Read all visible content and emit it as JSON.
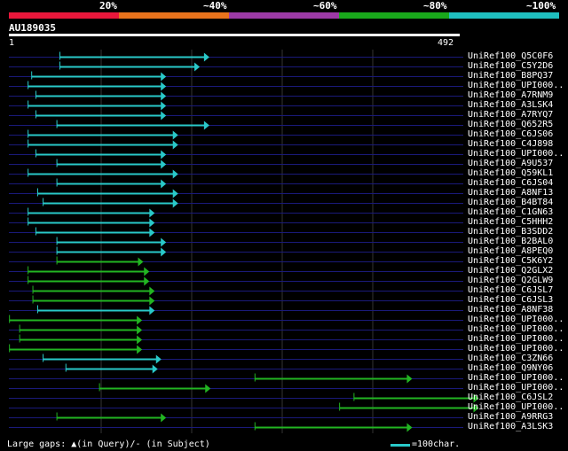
{
  "header": {
    "scale_labels": [
      "20%",
      "~40%",
      "~60%",
      "~80%",
      "~100%"
    ],
    "scale_colors": [
      "#e8173b",
      "#e8731c",
      "#9c3aa6",
      "#19a81b",
      "#1fbfbf"
    ],
    "query_id": "AU189035",
    "query_start": "1",
    "query_end": "492"
  },
  "colors": {
    "background": "#000000",
    "row_line": "#1a1a7a",
    "grid": "#333333",
    "cyan": "#29c9c9",
    "green": "#22b522"
  },
  "query_length": 492,
  "hits": [
    {
      "name": "UniRef100_Q5C0F6",
      "start": 85,
      "end": 334,
      "color": "cyan"
    },
    {
      "name": "UniRef100_C5Y2D6",
      "start": 85,
      "end": 318,
      "color": "cyan"
    },
    {
      "name": "UniRef100_B8PQ37",
      "start": 38,
      "end": 262,
      "color": "cyan"
    },
    {
      "name": "UniRef100_UPI000..",
      "start": 32,
      "end": 262,
      "color": "cyan"
    },
    {
      "name": "UniRef100_A7RNM9",
      "start": 45,
      "end": 262,
      "color": "cyan"
    },
    {
      "name": "UniRef100_A3LSK4",
      "start": 32,
      "end": 262,
      "color": "cyan"
    },
    {
      "name": "UniRef100_A7RYQ7",
      "start": 45,
      "end": 262,
      "color": "cyan"
    },
    {
      "name": "UniRef100_Q652R5",
      "start": 80,
      "end": 334,
      "color": "cyan"
    },
    {
      "name": "UniRef100_C6JS06",
      "start": 32,
      "end": 282,
      "color": "cyan"
    },
    {
      "name": "UniRef100_C4J898",
      "start": 32,
      "end": 282,
      "color": "cyan"
    },
    {
      "name": "UniRef100_UPI000..",
      "start": 45,
      "end": 262,
      "color": "cyan"
    },
    {
      "name": "UniRef100_A9U537",
      "start": 80,
      "end": 262,
      "color": "cyan"
    },
    {
      "name": "UniRef100_Q59KL1",
      "start": 32,
      "end": 282,
      "color": "cyan"
    },
    {
      "name": "UniRef100_C6JS04",
      "start": 80,
      "end": 262,
      "color": "cyan"
    },
    {
      "name": "UniRef100_A8NF13",
      "start": 48,
      "end": 282,
      "color": "cyan"
    },
    {
      "name": "UniRef100_B4BT84",
      "start": 57,
      "end": 282,
      "color": "cyan"
    },
    {
      "name": "UniRef100_C1GN63",
      "start": 32,
      "end": 243,
      "color": "cyan"
    },
    {
      "name": "UniRef100_C5HHH2",
      "start": 32,
      "end": 243,
      "color": "cyan"
    },
    {
      "name": "UniRef100_B3SDD2",
      "start": 45,
      "end": 243,
      "color": "cyan"
    },
    {
      "name": "UniRef100_B2BAL0",
      "start": 80,
      "end": 262,
      "color": "cyan"
    },
    {
      "name": "UniRef100_A8PEQ0",
      "start": 80,
      "end": 262,
      "color": "cyan"
    },
    {
      "name": "UniRef100_C5K6Y2",
      "start": 80,
      "end": 224,
      "color": "green"
    },
    {
      "name": "UniRef100_Q2GLX2",
      "start": 32,
      "end": 234,
      "color": "green"
    },
    {
      "name": "UniRef100_Q2GLW9",
      "start": 32,
      "end": 234,
      "color": "green"
    },
    {
      "name": "UniRef100_C6JSL7",
      "start": 40,
      "end": 243,
      "color": "green"
    },
    {
      "name": "UniRef100_C6JSL3",
      "start": 40,
      "end": 243,
      "color": "green"
    },
    {
      "name": "UniRef100_A8NF38",
      "start": 48,
      "end": 243,
      "color": "cyan"
    },
    {
      "name": "UniRef100_UPI000..",
      "start": 1,
      "end": 222,
      "color": "green"
    },
    {
      "name": "UniRef100_UPI000..",
      "start": 18,
      "end": 222,
      "color": "green"
    },
    {
      "name": "UniRef100_UPI000..",
      "start": 18,
      "end": 222,
      "color": "green"
    },
    {
      "name": "UniRef100_UPI000..",
      "start": 1,
      "end": 222,
      "color": "green"
    },
    {
      "name": "UniRef100_C3ZN66",
      "start": 57,
      "end": 254,
      "color": "cyan"
    },
    {
      "name": "UniRef100_Q9NY06",
      "start": 95,
      "end": 248,
      "color": "cyan"
    },
    {
      "name": "UniRef100_UPI000..",
      "start": 410,
      "end": 672,
      "color": "green"
    },
    {
      "name": "UniRef100_UPI000..",
      "start": 151,
      "end": 336,
      "color": "green"
    },
    {
      "name": "UniRef100_C6JSL2",
      "start": 575,
      "end": 783,
      "color": "green"
    },
    {
      "name": "UniRef100_UPI000..",
      "start": 551,
      "end": 783,
      "color": "green"
    },
    {
      "name": "UniRef100_A9RRG3",
      "start": 80,
      "end": 262,
      "color": "green"
    },
    {
      "name": "UniRef100_A3LSK3",
      "start": 410,
      "end": 672,
      "color": "green"
    }
  ],
  "footer": {
    "gaps_legend": "Large gaps: ▲(in Query)/- (in Subject)",
    "scale_legend": "=100char."
  }
}
